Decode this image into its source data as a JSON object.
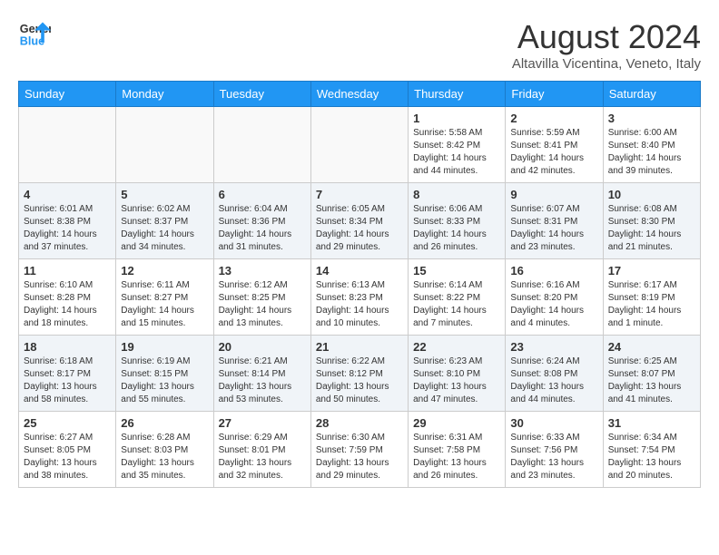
{
  "header": {
    "logo_general": "General",
    "logo_blue": "Blue",
    "month_title": "August 2024",
    "subtitle": "Altavilla Vicentina, Veneto, Italy"
  },
  "days_of_week": [
    "Sunday",
    "Monday",
    "Tuesday",
    "Wednesday",
    "Thursday",
    "Friday",
    "Saturday"
  ],
  "weeks": [
    [
      {
        "num": "",
        "info": ""
      },
      {
        "num": "",
        "info": ""
      },
      {
        "num": "",
        "info": ""
      },
      {
        "num": "",
        "info": ""
      },
      {
        "num": "1",
        "info": "Sunrise: 5:58 AM\nSunset: 8:42 PM\nDaylight: 14 hours and 44 minutes."
      },
      {
        "num": "2",
        "info": "Sunrise: 5:59 AM\nSunset: 8:41 PM\nDaylight: 14 hours and 42 minutes."
      },
      {
        "num": "3",
        "info": "Sunrise: 6:00 AM\nSunset: 8:40 PM\nDaylight: 14 hours and 39 minutes."
      }
    ],
    [
      {
        "num": "4",
        "info": "Sunrise: 6:01 AM\nSunset: 8:38 PM\nDaylight: 14 hours and 37 minutes."
      },
      {
        "num": "5",
        "info": "Sunrise: 6:02 AM\nSunset: 8:37 PM\nDaylight: 14 hours and 34 minutes."
      },
      {
        "num": "6",
        "info": "Sunrise: 6:04 AM\nSunset: 8:36 PM\nDaylight: 14 hours and 31 minutes."
      },
      {
        "num": "7",
        "info": "Sunrise: 6:05 AM\nSunset: 8:34 PM\nDaylight: 14 hours and 29 minutes."
      },
      {
        "num": "8",
        "info": "Sunrise: 6:06 AM\nSunset: 8:33 PM\nDaylight: 14 hours and 26 minutes."
      },
      {
        "num": "9",
        "info": "Sunrise: 6:07 AM\nSunset: 8:31 PM\nDaylight: 14 hours and 23 minutes."
      },
      {
        "num": "10",
        "info": "Sunrise: 6:08 AM\nSunset: 8:30 PM\nDaylight: 14 hours and 21 minutes."
      }
    ],
    [
      {
        "num": "11",
        "info": "Sunrise: 6:10 AM\nSunset: 8:28 PM\nDaylight: 14 hours and 18 minutes."
      },
      {
        "num": "12",
        "info": "Sunrise: 6:11 AM\nSunset: 8:27 PM\nDaylight: 14 hours and 15 minutes."
      },
      {
        "num": "13",
        "info": "Sunrise: 6:12 AM\nSunset: 8:25 PM\nDaylight: 14 hours and 13 minutes."
      },
      {
        "num": "14",
        "info": "Sunrise: 6:13 AM\nSunset: 8:23 PM\nDaylight: 14 hours and 10 minutes."
      },
      {
        "num": "15",
        "info": "Sunrise: 6:14 AM\nSunset: 8:22 PM\nDaylight: 14 hours and 7 minutes."
      },
      {
        "num": "16",
        "info": "Sunrise: 6:16 AM\nSunset: 8:20 PM\nDaylight: 14 hours and 4 minutes."
      },
      {
        "num": "17",
        "info": "Sunrise: 6:17 AM\nSunset: 8:19 PM\nDaylight: 14 hours and 1 minute."
      }
    ],
    [
      {
        "num": "18",
        "info": "Sunrise: 6:18 AM\nSunset: 8:17 PM\nDaylight: 13 hours and 58 minutes."
      },
      {
        "num": "19",
        "info": "Sunrise: 6:19 AM\nSunset: 8:15 PM\nDaylight: 13 hours and 55 minutes."
      },
      {
        "num": "20",
        "info": "Sunrise: 6:21 AM\nSunset: 8:14 PM\nDaylight: 13 hours and 53 minutes."
      },
      {
        "num": "21",
        "info": "Sunrise: 6:22 AM\nSunset: 8:12 PM\nDaylight: 13 hours and 50 minutes."
      },
      {
        "num": "22",
        "info": "Sunrise: 6:23 AM\nSunset: 8:10 PM\nDaylight: 13 hours and 47 minutes."
      },
      {
        "num": "23",
        "info": "Sunrise: 6:24 AM\nSunset: 8:08 PM\nDaylight: 13 hours and 44 minutes."
      },
      {
        "num": "24",
        "info": "Sunrise: 6:25 AM\nSunset: 8:07 PM\nDaylight: 13 hours and 41 minutes."
      }
    ],
    [
      {
        "num": "25",
        "info": "Sunrise: 6:27 AM\nSunset: 8:05 PM\nDaylight: 13 hours and 38 minutes."
      },
      {
        "num": "26",
        "info": "Sunrise: 6:28 AM\nSunset: 8:03 PM\nDaylight: 13 hours and 35 minutes."
      },
      {
        "num": "27",
        "info": "Sunrise: 6:29 AM\nSunset: 8:01 PM\nDaylight: 13 hours and 32 minutes."
      },
      {
        "num": "28",
        "info": "Sunrise: 6:30 AM\nSunset: 7:59 PM\nDaylight: 13 hours and 29 minutes."
      },
      {
        "num": "29",
        "info": "Sunrise: 6:31 AM\nSunset: 7:58 PM\nDaylight: 13 hours and 26 minutes."
      },
      {
        "num": "30",
        "info": "Sunrise: 6:33 AM\nSunset: 7:56 PM\nDaylight: 13 hours and 23 minutes."
      },
      {
        "num": "31",
        "info": "Sunrise: 6:34 AM\nSunset: 7:54 PM\nDaylight: 13 hours and 20 minutes."
      }
    ]
  ]
}
